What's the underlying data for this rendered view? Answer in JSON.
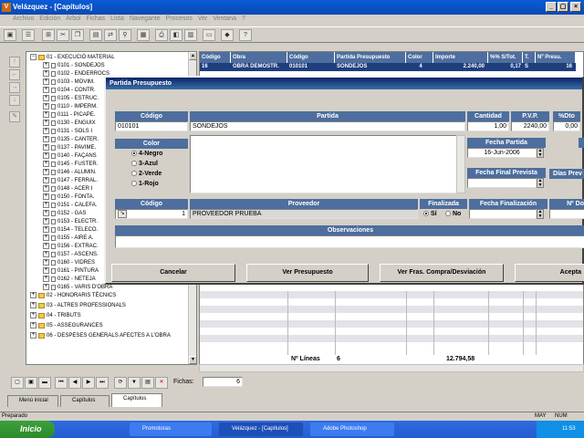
{
  "window": {
    "title": "Velázquez - [Capítulos]",
    "logo": "V",
    "min": "_",
    "max": "▢",
    "close": "×"
  },
  "menu": [
    "Archivo",
    "Edición",
    "Árbol",
    "Fichas",
    "Lista",
    "Navegante",
    "Procesos",
    "Ver",
    "Ventana",
    "?"
  ],
  "tree": {
    "root": "01 - EXECUCIÓ MATERIAL",
    "items": [
      "0101 - SONDEJOS",
      "0102 - ENDERROCS",
      "0103 - MOVIM.",
      "0104 - CONTR.",
      "0105 - ESTRUC.",
      "0110 - IMPERM.",
      "0111 - PICAPE.",
      "0130 - ENGUIX",
      "0131 - SOLS I",
      "0135 - CANTER.",
      "0137 - PAVIME.",
      "0140 - FAÇANS",
      "0145 - FUSTER.",
      "0146 - ALUMIN.",
      "0147 - FERRAL.",
      "0148 - ACER I",
      "0150 - FONTA.",
      "0151 - CALEFA.",
      "0152 - GAS",
      "0153 - ELECTR.",
      "0154 - TELECO.",
      "0155 - AIRE A.",
      "0156 - EXTRAC.",
      "0157 - ASCENS.",
      "0160 - VIDRES",
      "0161 - PINTURA",
      "0162 - NETEJA",
      "0165 - VARIS D'OBRA"
    ],
    "groups": [
      "02 - HONORARIS TÈCNICS",
      "03 - ALTRES PROFESSIONALS",
      "04 - TRIBUTS",
      "05 - ASSEGURANCES",
      "06 - DESPESES GENERALS AFECTES A L'OBRA"
    ]
  },
  "grid": {
    "headers": [
      "Código",
      "Obra",
      "Código",
      "Partida Presupuesto",
      "Color",
      "Importe",
      "%% S/Tot.",
      "T.",
      "Nº Presu."
    ],
    "row": [
      "16",
      "OBRA DEMOSTR.",
      "010101",
      "SONDEJOS",
      "4",
      "2.240,00",
      "0,17",
      "S",
      "16"
    ],
    "footer_label": "Nº Líneas",
    "footer_count": "6",
    "footer_total": "12.794,58"
  },
  "dialog": {
    "title": "Partida Presupuesto",
    "codigo_label": "Código",
    "codigo": "010101",
    "partida_label": "Partida",
    "partida": "SONDEJOS",
    "cantidad_label": "Cantidad",
    "cantidad": "1,00",
    "pvp_label": "P.V.P.",
    "pvp": "2240,00",
    "dto_label": "%Dto",
    "dto": "0,00",
    "color_label": "Color",
    "colors": [
      "4-Negro",
      "3-Azul",
      "2-Verde",
      "1-Rojo"
    ],
    "fecha_partida_label": "Fecha Partida",
    "fecha_partida": "16-Jun-2006",
    "fecha_final_label": "Fecha Final Prevista",
    "dias_label": "Días Prev",
    "prov_codigo_label": "Código",
    "prov_codigo": "1",
    "proveedor_label": "Proveedor",
    "proveedor": "PROVEEDOR PRUEBA",
    "finalizada_label": "Finalizada",
    "si": "Sí",
    "no": "No",
    "fecha_fin_label": "Fecha Finalización",
    "num_label": "Nº Do",
    "obs_label": "Observaciones",
    "btn_cancelar": "Cancelar",
    "btn_ver_presupuesto": "Ver Presupuesto",
    "btn_ver_fras": "Ver Fras. Compra/Desviación",
    "btn_aceptar": "Acepta"
  },
  "bottom": {
    "fichas_label": "Fichas:",
    "fichas_count": "6"
  },
  "tabs": [
    "Menú inicial",
    "Capítulos",
    "Capítulos"
  ],
  "status": {
    "left": "Preparado",
    "may": "MAY",
    "num": "NUM"
  },
  "taskbar": {
    "start": "Inicio",
    "tasks": [
      "Promotoras",
      "Velázquez - [Capítulos]",
      "Adobe Photoshop"
    ],
    "clock": "11:53"
  },
  "colors": {
    "header_blue": "#4d6e9e",
    "selected_row": "#1e3e7e",
    "title_blue": "#0a246a",
    "taskbar": "#245cd2"
  }
}
